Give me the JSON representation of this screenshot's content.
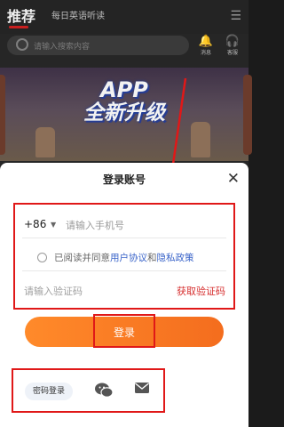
{
  "header": {
    "tabs": [
      "推荐",
      "每日英语听读"
    ],
    "active_tab": 0,
    "search_placeholder": "请输入搜索内容",
    "icons": [
      {
        "name": "message-icon",
        "label": "消息"
      },
      {
        "name": "service-icon",
        "label": "客服"
      }
    ]
  },
  "banner": {
    "line1": "APP",
    "line2": "全新升级"
  },
  "sheet": {
    "title": "登录账号",
    "country_code": "+86",
    "phone_placeholder": "请输入手机号",
    "agree_prefix": "已阅读并同意",
    "user_agreement": "用户协议",
    "and": "和",
    "privacy_policy": "隐私政策",
    "code_placeholder": "请输入验证码",
    "get_code": "获取验证码",
    "login": "登录",
    "password_login": "密码登录"
  },
  "colors": {
    "highlight": "#e01818",
    "login_gradient": [
      "#ff8a2a",
      "#f46d1e"
    ],
    "link": "#3a64c9",
    "get_code": "#d62e2e"
  }
}
